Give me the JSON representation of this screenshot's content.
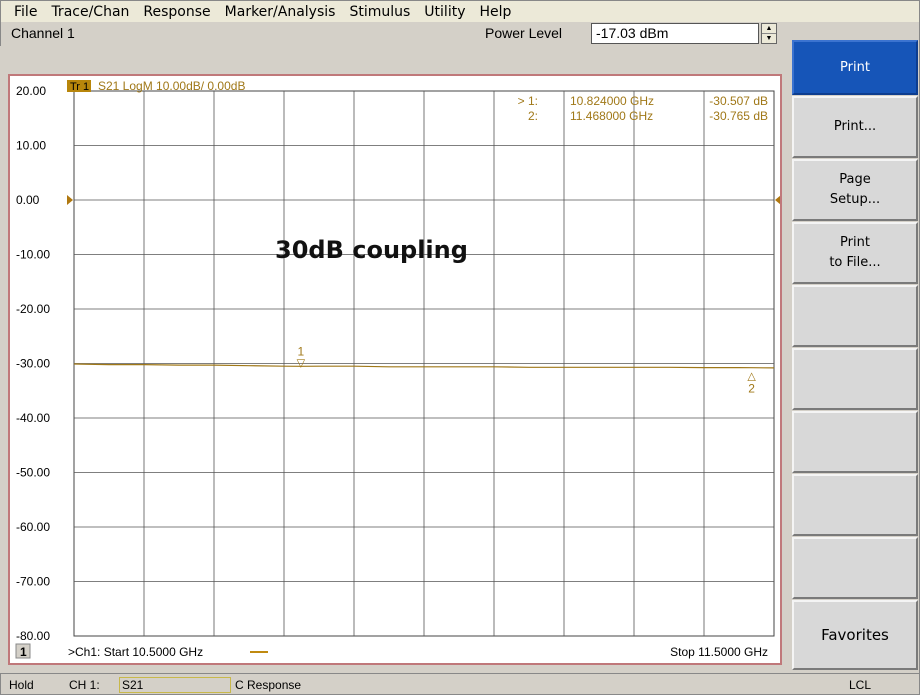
{
  "menu": [
    "File",
    "Trace/Chan",
    "Response",
    "Marker/Analysis",
    "Stimulus",
    "Utility",
    "Help"
  ],
  "toolbar": {
    "channel": "Channel 1",
    "power_label": "Power Level",
    "power_value": "-17.03 dBm"
  },
  "softkeys": {
    "print": "Print",
    "print_dialog": "Print...",
    "page_setup_1": "Page",
    "page_setup_2": "Setup...",
    "print_file_1": "Print",
    "print_file_2": "to File...",
    "favorites": "Favorites"
  },
  "trace": {
    "tag": "Tr 1",
    "label": "S21 LogM 10.00dB/ 0.00dB",
    "color": "#a07818",
    "ref_marker_color": "#b07810"
  },
  "markers": [
    {
      "id": "1",
      "row_label": "> 1:",
      "freq": "10.824000 GHz",
      "value": "-30.507 dB",
      "freq_ghz": 10.824,
      "db": -30.507,
      "symbol": "▽"
    },
    {
      "id": "2",
      "row_label": "2:",
      "freq": "11.468000 GHz",
      "value": "-30.765 dB",
      "freq_ghz": 11.468,
      "db": -30.765,
      "symbol": "△"
    }
  ],
  "annotation": "30dB coupling",
  "footer": {
    "channel_box": "1",
    "start": ">Ch1: Start  10.5000 GHz",
    "stop": "Stop  11.5000 GHz"
  },
  "status": {
    "hold": "Hold",
    "ch": "CH 1:",
    "meas": "S21",
    "mode": "C  Response",
    "lcl": "LCL"
  },
  "chart_data": {
    "type": "line",
    "xlim": [
      10.5,
      11.5
    ],
    "ylim": [
      -80,
      20
    ],
    "y_ticks": [
      "20.00",
      "10.00",
      "0.00",
      "-10.00",
      "-20.00",
      "-30.00",
      "-40.00",
      "-50.00",
      "-60.00",
      "-70.00",
      "-80.00"
    ],
    "grid": true,
    "series": [
      {
        "x": [
          10.5,
          10.55,
          10.6,
          10.65,
          10.7,
          10.75,
          10.8,
          10.824,
          10.85,
          10.9,
          10.95,
          11.0,
          11.05,
          11.1,
          11.15,
          11.2,
          11.25,
          11.3,
          11.35,
          11.4,
          11.45,
          11.468,
          11.5
        ],
        "y": [
          -30.1,
          -30.2,
          -30.2,
          -30.3,
          -30.3,
          -30.4,
          -30.5,
          -30.507,
          -30.5,
          -30.5,
          -30.6,
          -30.6,
          -30.6,
          -30.6,
          -30.7,
          -30.7,
          -30.7,
          -30.7,
          -30.7,
          -30.75,
          -30.76,
          -30.765,
          -30.8
        ]
      }
    ]
  }
}
